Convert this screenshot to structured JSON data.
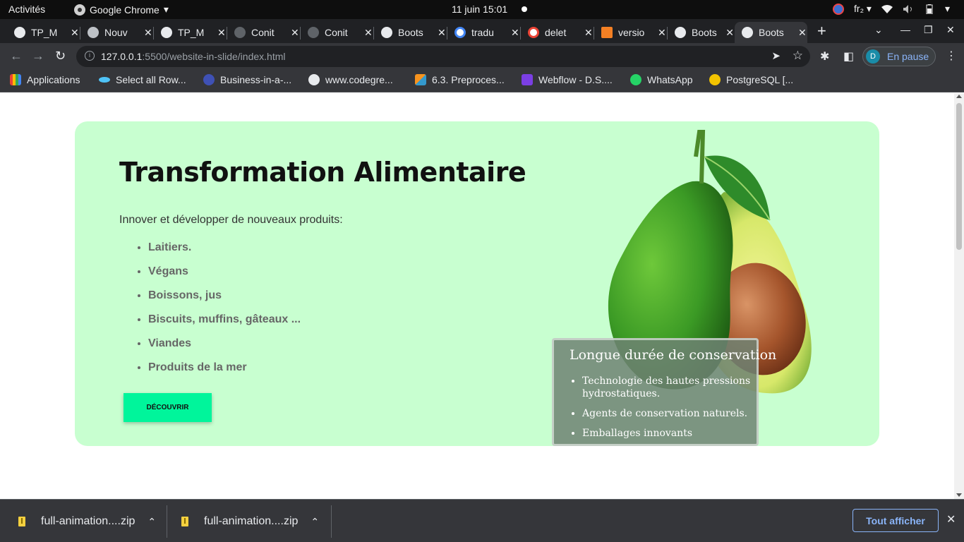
{
  "os_bar": {
    "activities": "Activités",
    "app_name": "Google Chrome",
    "clock": "11 juin  15:01",
    "keyboard_layout": "fr₂"
  },
  "tabs": [
    {
      "title": "TP_M",
      "icon": "globe-icon"
    },
    {
      "title": "Nouv",
      "icon": "chrome-icon"
    },
    {
      "title": "TP_M",
      "icon": "globe-icon"
    },
    {
      "title": "Conit",
      "icon": "github-icon"
    },
    {
      "title": "Conit",
      "icon": "github-icon"
    },
    {
      "title": "Boots",
      "icon": "globe-icon"
    },
    {
      "title": "tradu",
      "icon": "google-icon"
    },
    {
      "title": "delet",
      "icon": "google-icon"
    },
    {
      "title": "versio",
      "icon": "stackoverflow-icon"
    },
    {
      "title": "Boots",
      "icon": "globe-icon"
    },
    {
      "title": "Boots",
      "icon": "globe-icon",
      "active": true
    }
  ],
  "toolbar": {
    "url_host": "127.0.0.1",
    "url_path": ":5500/website-in-slide/index.html",
    "profile_initial": "D",
    "profile_label": "En pause"
  },
  "bookmarks": [
    {
      "label": "Applications",
      "icon": "apps-grid-icon",
      "color": "#e8eaed"
    },
    {
      "label": "Select all Row...",
      "icon": "fish-icon",
      "color": "#4fc3f7"
    },
    {
      "label": "Business-in-a-...",
      "icon": "circle-logo-icon",
      "color": "#3f51b5"
    },
    {
      "label": "www.codegre...",
      "icon": "globe-icon",
      "color": "#e8eaed"
    },
    {
      "label": "6.3. Preproces...",
      "icon": "scikit-icon",
      "color": "#f7931e"
    },
    {
      "label": "Webflow - D.S....",
      "icon": "webflow-icon",
      "color": "#7b3fe4"
    },
    {
      "label": "WhatsApp",
      "icon": "whatsapp-icon",
      "color": "#25d366"
    },
    {
      "label": "PostgreSQL [...",
      "icon": "database-icon",
      "color": "#f2c300"
    }
  ],
  "page": {
    "title": "Transformation Alimentaire",
    "intro": "Innover et développer de nouveaux produits:",
    "products": [
      "Laitiers.",
      "Végans",
      "Boissons, jus",
      "Biscuits, muffins, gâteaux ...",
      "Viandes",
      "Produits de la mer"
    ],
    "cta": "DÉCOUVRIR",
    "card_color": "#c8ffd0",
    "cta_color": "#00f59b",
    "overlay": {
      "title": "Longue durée de conservation",
      "items": [
        "Technologie des hautes pressions hydrostatiques.",
        "Agents de conservation naturels.",
        "Emballages innovants"
      ]
    }
  },
  "downloads": {
    "items": [
      "full-animation....zip",
      "full-animation....zip"
    ],
    "show_all": "Tout afficher"
  }
}
